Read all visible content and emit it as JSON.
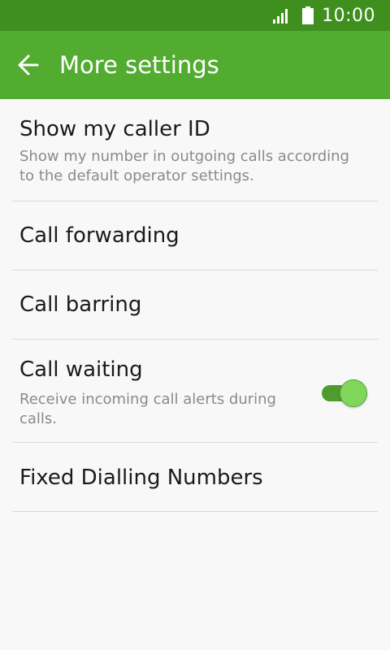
{
  "status_bar": {
    "time": "10:00",
    "signal_icon": "signal-icon",
    "battery_icon": "battery-icon"
  },
  "app_bar": {
    "title": "More settings",
    "back_icon": "arrow-left-icon"
  },
  "settings": [
    {
      "title": "Show my caller ID",
      "subtitle": "Show my number in outgoing calls according to the default operator settings."
    },
    {
      "title": "Call forwarding"
    },
    {
      "title": "Call barring"
    },
    {
      "title": "Call waiting",
      "subtitle": "Receive incoming call alerts during calls.",
      "toggle_on": true
    },
    {
      "title": "Fixed Dialling Numbers"
    }
  ],
  "colors": {
    "status_bar": "#3f8f1f",
    "app_bar": "#52ac30",
    "accent": "#7fd65a"
  }
}
